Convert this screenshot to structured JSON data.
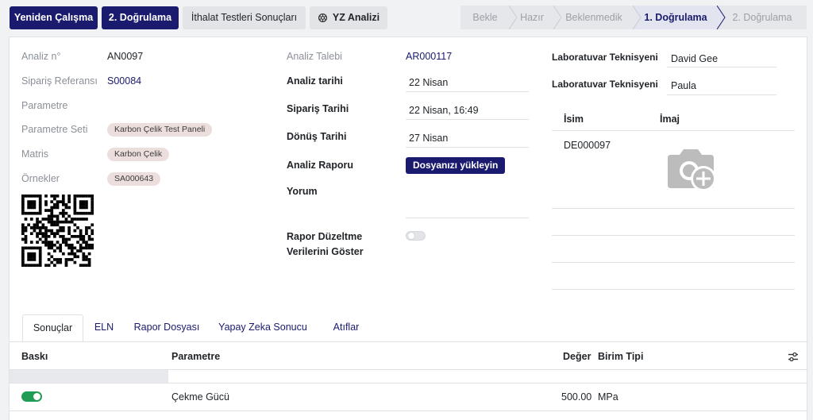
{
  "toolbar": {
    "reanalyze": "Yeniden Çalışma",
    "validate2": "2. Doğrulama",
    "import_results": "İthalat Testleri Sonuçları",
    "ai_analysis": "YZ Analizi"
  },
  "statusbar": {
    "stages": [
      "Bekle",
      "Hazır",
      "Beklenmedik",
      "1. Doğrulama",
      "2. Doğrulama"
    ],
    "active": "1. Doğrulama"
  },
  "form": {
    "analysis_no_label": "Analiz n°",
    "analysis_no": "AN0097",
    "order_ref_label": "Sipariş Referansı",
    "order_ref": "S00084",
    "parameter_label": "Parametre",
    "parameter_set_label": "Parametre Seti",
    "parameter_set": "Karbon Çelik Test Paneli",
    "matrix_label": "Matris",
    "matrix": "Karbon Çelik",
    "samples_label": "Örnekler",
    "samples": "SA000643",
    "analysis_request_label": "Analiz Talebi",
    "analysis_request": "AR000117",
    "analysis_date_label": "Analiz tarihi",
    "analysis_date": "22 Nisan",
    "order_date_label": "Sipariş Tarihi",
    "order_date": "22 Nisan, 16:49",
    "return_date_label": "Dönüş Tarihi",
    "return_date": "27 Nisan",
    "report_label": "Analiz Raporu",
    "upload_label": "Dosyanızı yükleyin",
    "comment_label": "Yorum",
    "report_fix_label_1": "Rapor Düzeltme",
    "report_fix_label_2": "Verilerini Göster",
    "lab_tech_label": "Laboratuvar Teknisyeni",
    "lab_tech_1": "David Gee",
    "lab_tech_2": "Paula",
    "name_col": "İsim",
    "image_col": "İmaj",
    "device_id": "DE000097"
  },
  "tabs": [
    "Sonuçlar",
    "ELN",
    "Rapor Dosyası",
    "Yapay Zeka Sonucu",
    "Atıflar"
  ],
  "results": {
    "headers": {
      "print": "Baskı",
      "parameter": "Parametre",
      "value": "Değer",
      "unit_type": "Birim Tipi"
    },
    "rows": [
      {
        "parameter": "Çekme Gücü",
        "value": "500.00",
        "unit": "MPa"
      }
    ]
  },
  "colors": {
    "brand": "#1a1a6e",
    "toggle_on": "#1f9d55",
    "tag_bg": "#ecdedd"
  }
}
